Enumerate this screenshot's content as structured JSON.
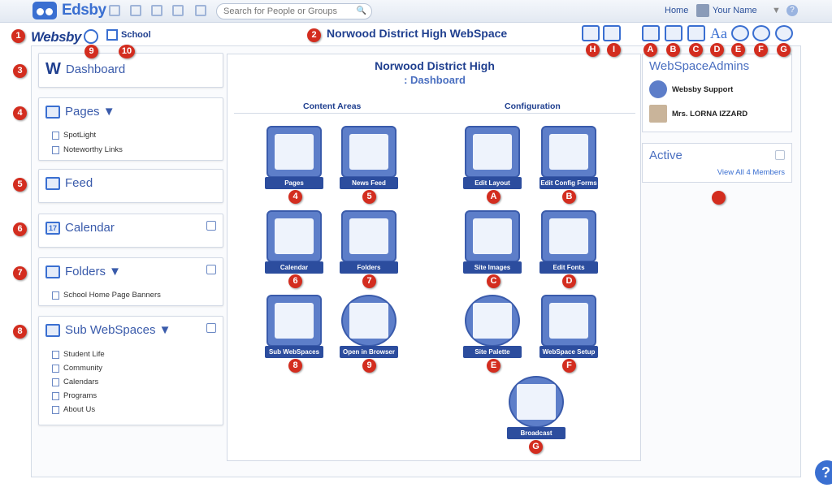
{
  "app": {
    "name": "Edsby"
  },
  "search": {
    "placeholder": "Search for People or Groups"
  },
  "top_links": {
    "home": "Home",
    "user": "Your Name"
  },
  "header": {
    "logo": "Websby",
    "school": "School",
    "title": "Norwood District High WebSpace"
  },
  "markers": {
    "n1": "1",
    "n2": "2",
    "n3": "3",
    "n4": "4",
    "n5": "5",
    "n6": "6",
    "n7": "7",
    "n8": "8",
    "n9": "9",
    "n10": "10",
    "A": "A",
    "B": "B",
    "C": "C",
    "D": "D",
    "E": "E",
    "F": "F",
    "G": "G",
    "H": "H",
    "I": "I"
  },
  "sidebar": {
    "dashboard": "Dashboard",
    "pages": {
      "title": "Pages ▼",
      "items": [
        "SpotLight",
        "Noteworthy Links"
      ]
    },
    "feed": "Feed",
    "calendar": "Calendar",
    "folders": {
      "title": "Folders ▼",
      "items": [
        "School Home Page Banners"
      ]
    },
    "subwebspaces": {
      "title": "Sub WebSpaces ▼",
      "items": [
        "Student Life",
        "Community",
        "Calendars",
        "Programs",
        "About Us"
      ]
    }
  },
  "center": {
    "title": "Norwood District High",
    "subtitle": ": Dashboard",
    "content_areas": "Content Areas",
    "configuration": "Configuration",
    "tiles": {
      "pages": "Pages",
      "news_feed": "News Feed",
      "calendar": "Calendar",
      "folders": "Folders",
      "sub_webspaces": "Sub WebSpaces",
      "open_browser": "Open in Browser",
      "edit_layout": "Edit Layout",
      "edit_config": "Edit Config Forms",
      "site_images": "Site Images",
      "edit_fonts": "Edit Fonts",
      "site_palette": "Site Palette",
      "webspace_setup": "WebSpace Setup",
      "broadcast": "Broadcast"
    }
  },
  "right": {
    "admins_title": "WebSpaceAdmins",
    "admins": [
      "Websby Support",
      "Mrs. LORNA IZZARD"
    ],
    "active_title": "Active",
    "view_all": "View All 4 Members"
  },
  "icons": {
    "calendar_day": "17"
  }
}
